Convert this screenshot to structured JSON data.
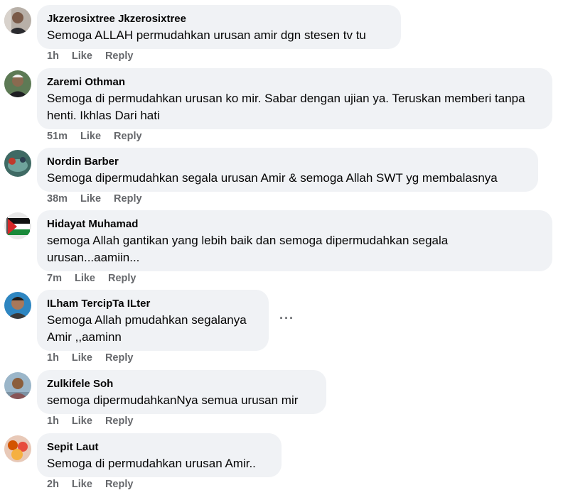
{
  "comments": [
    {
      "name": "Jkzerosixtree Jkzerosixtree",
      "text": "Semoga ALLAH permudahkan urusan amir dgn stesen tv tu",
      "time": "1h",
      "like": "Like",
      "reply": "Reply",
      "avatar_icon": "profile-photo"
    },
    {
      "name": "Zaremi Othman",
      "text": "Semoga di permudahkan urusan ko mir. Sabar dengan ujian ya. Teruskan memberi tanpa henti. Ikhlas Dari hati",
      "time": "51m",
      "like": "Like",
      "reply": "Reply",
      "avatar_icon": "profile-photo"
    },
    {
      "name": "Nordin Barber",
      "text": "Semoga dipermudahkan segala urusan Amir & semoga Allah SWT yg membalasnya",
      "time": "38m",
      "like": "Like",
      "reply": "Reply",
      "avatar_icon": "profile-photo"
    },
    {
      "name": "Hidayat Muhamad",
      "text": "semoga Allah gantikan yang lebih baik dan semoga dipermudahkan segala urusan...aamiin...",
      "time": "7m",
      "like": "Like",
      "reply": "Reply",
      "avatar_icon": "palestine-flag-icon"
    },
    {
      "name": "ILham TercipTa ILter",
      "text": "Semoga Allah pmudahkan segalanya Amir ,,aaminn",
      "time": "1h",
      "like": "Like",
      "reply": "Reply",
      "more": "···",
      "avatar_icon": "profile-photo"
    },
    {
      "name": "Zulkifele Soh",
      "text": "semoga dipermudahkanNya semua urusan mir",
      "time": "1h",
      "like": "Like",
      "reply": "Reply",
      "avatar_icon": "profile-photo"
    },
    {
      "name": "Sepit Laut",
      "text": "Semoga di permudahkan urusan Amir..",
      "time": "2h",
      "like": "Like",
      "reply": "Reply",
      "avatar_icon": "profile-photo"
    }
  ]
}
